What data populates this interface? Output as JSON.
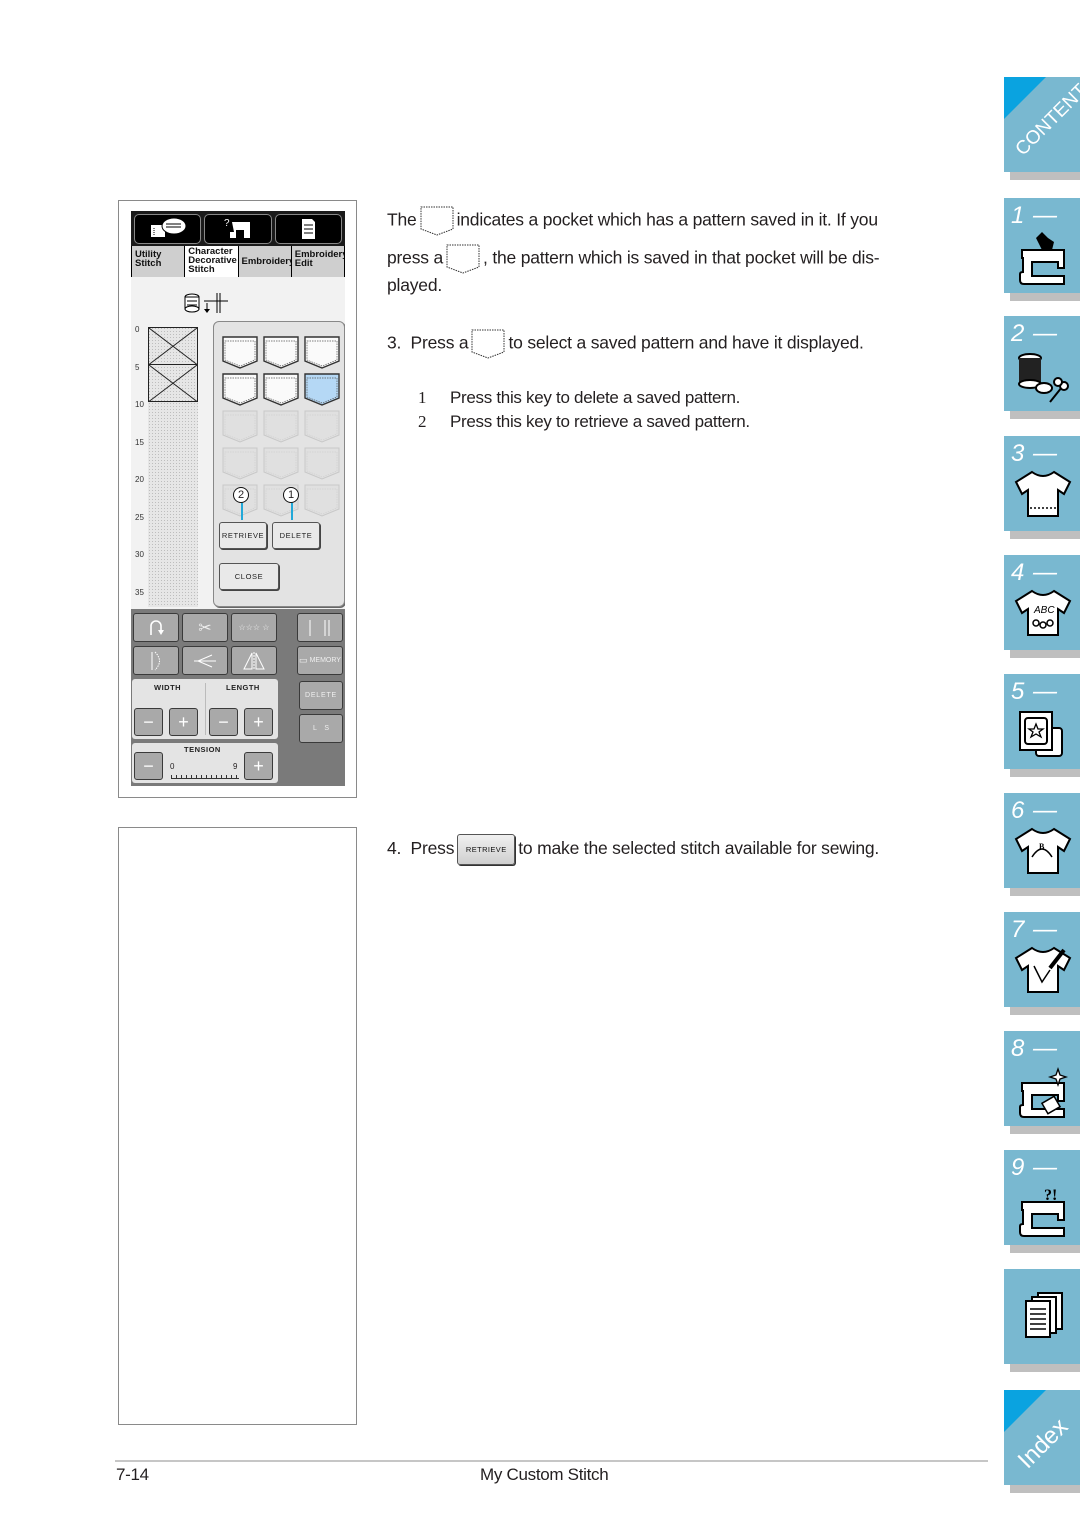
{
  "screen": {
    "top_buttons": [
      {
        "icon": "stitch-book-icon"
      },
      {
        "icon": "help-machine-icon"
      },
      {
        "icon": "settings-sheet-icon"
      }
    ],
    "mode_tabs": [
      {
        "label_lines": [
          "Utility",
          "Stitch"
        ],
        "active": false
      },
      {
        "label_lines": [
          "Character",
          "Decorative",
          "Stitch"
        ],
        "active": true
      },
      {
        "label_lines": [
          "Embroidery"
        ],
        "active": false
      },
      {
        "label_lines": [
          "Embroidery",
          "Edit"
        ],
        "active": false
      }
    ],
    "ruler_ticks": [
      "0",
      "5",
      "10",
      "15",
      "20",
      "25",
      "30",
      "35"
    ],
    "pockets": {
      "rows": 5,
      "columns": 3,
      "saved_count": 6,
      "selected_index": 5
    },
    "callouts": {
      "retrieve": "2",
      "delete": "1"
    },
    "buttons": {
      "retrieve": "RETRIEVE",
      "delete": "DELETE",
      "close": "CLOSE"
    },
    "control_panel": {
      "memory": "MEMORY",
      "delete": "DELETE",
      "ls": "L    S",
      "width_label": "WIDTH",
      "length_label": "LENGTH",
      "tension_label": "TENSION",
      "tension_min": "0",
      "tension_max": "9",
      "minus": "−",
      "plus": "+"
    }
  },
  "text": {
    "para1_a": "The",
    "para1_b": "indicates a pocket which has a pattern saved in it. If you",
    "para1_c": "press a",
    "para1_d": ", the pattern which is saved in that pocket will be dis-",
    "para1_e": "played.",
    "step3_num": "3.",
    "step3_a": "Press a",
    "step3_b": "to select a saved pattern and have it displayed.",
    "notes": [
      {
        "num": "1",
        "text": "Press this key to delete a saved pattern."
      },
      {
        "num": "2",
        "text": "Press this key to retrieve a saved pattern."
      }
    ],
    "step4_num": "4.",
    "step4_a": "Press",
    "step4_button": "RETRIEVE",
    "step4_b": "to make the selected stitch available for sewing."
  },
  "side_tabs": {
    "contents": "CONTENTS",
    "chapters": [
      "1 —",
      "2 —",
      "3 —",
      "4 —",
      "5 —",
      "6 —",
      "7 —",
      "8 —",
      "9 —"
    ],
    "index": "Index",
    "abc_text": "ABC",
    "color": "#79b8d0",
    "corner_color": "#0aa3e0"
  },
  "footer": {
    "page_number": "7-14",
    "section_title": "My Custom Stitch"
  }
}
